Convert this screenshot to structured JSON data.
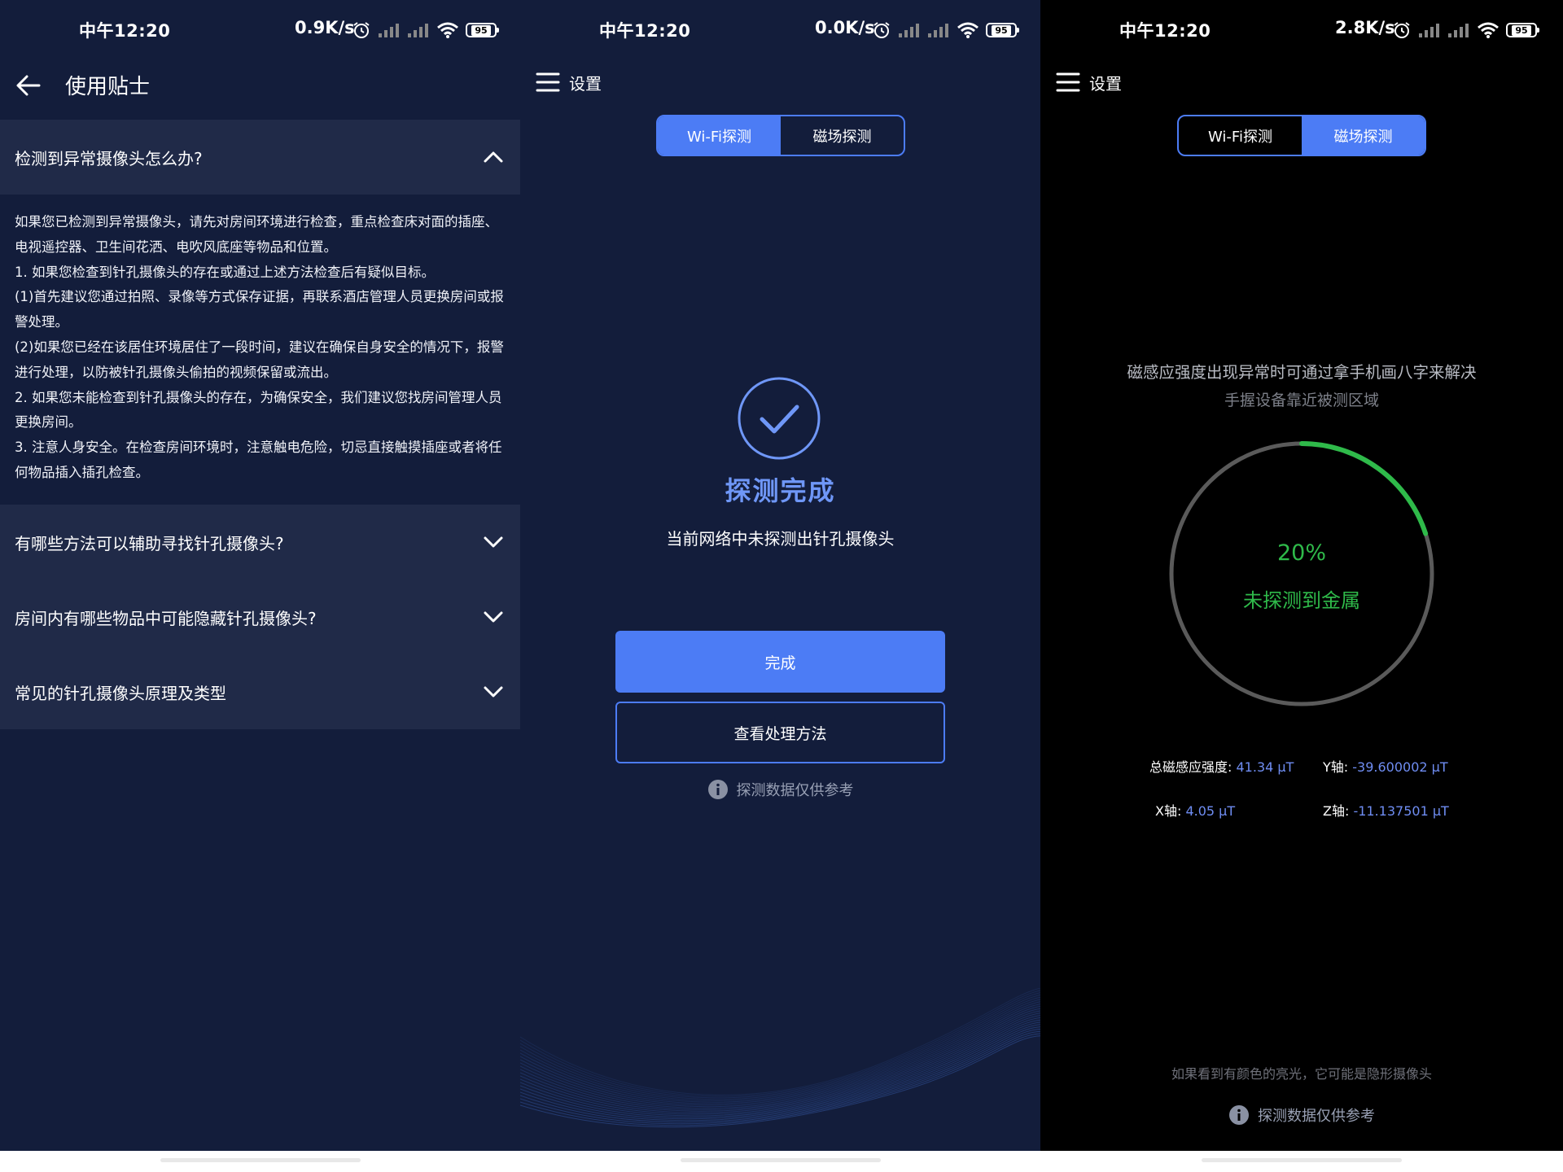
{
  "status_bars": [
    {
      "time": "中午12:20",
      "speed": "0.9K/s",
      "battery": "95"
    },
    {
      "time": "中午12:20",
      "speed": "0.0K/s",
      "battery": "95"
    },
    {
      "time": "中午12:20",
      "speed": "2.8K/s",
      "battery": "95"
    }
  ],
  "tips": {
    "title": "使用贴士",
    "open_question": "检测到异常摄像头怎么办?",
    "answer_lines": [
      "如果您已检测到异常摄像头，请先对房间环境进行检查，重点检查床对面的插座、电视遥控器、卫生间花洒、电吹风底座等物品和位置。",
      " 1. 如果您检查到针孔摄像头的存在或通过上述方法检查后有疑似目标。",
      "(1)首先建议您通过拍照、录像等方式保存证据，再联系酒店管理人员更换房间或报警处理。",
      "(2)如果您已经在该居住环境居住了一段时间，建议在确保自身安全的情况下，报警进行处理，以防被针孔摄像头偷拍的视频保留或流出。",
      " 2. 如果您未能检查到针孔摄像头的存在，为确保安全，我们建议您找房间管理人员更换房间。",
      " 3. 注意人身安全。在检查房间环境时，注意触电危险，切忌直接触摸插座或者将任何物品插入插孔检查。"
    ],
    "collapsed_questions": [
      "有哪些方法可以辅助寻找针孔摄像头?",
      "房间内有哪些物品中可能隐藏针孔摄像头?",
      "常见的针孔摄像头原理及类型"
    ]
  },
  "wifi_screen": {
    "settings_label": "设置",
    "tab_wifi": "Wi-Fi探测",
    "tab_magnetic": "磁场探测",
    "result_title": "探测完成",
    "result_sub": "当前网络中未探测出针孔摄像头",
    "done_button": "完成",
    "method_button": "查看处理方法",
    "disclaimer": "探测数据仅供参考"
  },
  "magnetic_screen": {
    "settings_label": "设置",
    "tab_wifi": "Wi-Fi探测",
    "tab_magnetic": "磁场探测",
    "hint_main": "磁感应强度出现异常时可通过拿手机画八字来解决",
    "hint_sub": "手握设备靠近被测区域",
    "progress_fraction": 0.2,
    "percent": "20%",
    "status": "未探测到金属",
    "total_label": "总磁感应强度:",
    "total_value": "41.34 μT",
    "y_label": "Y轴:",
    "y_value": "-39.600002 μT",
    "x_label": "X轴:",
    "x_value": "4.05 μT",
    "z_label": "Z轴:",
    "z_value": "-11.137501 μT",
    "footer_hint": "如果看到有颜色的亮光，它可能是隐形摄像头",
    "disclaimer": "探测数据仅供参考"
  },
  "colors": {
    "accent_blue": "#4c7cf5",
    "navy_bg": "#131d3b",
    "accordion_bg": "#202a48",
    "success_green": "#2fba4a",
    "gauge_track": "#5a5a5a"
  }
}
